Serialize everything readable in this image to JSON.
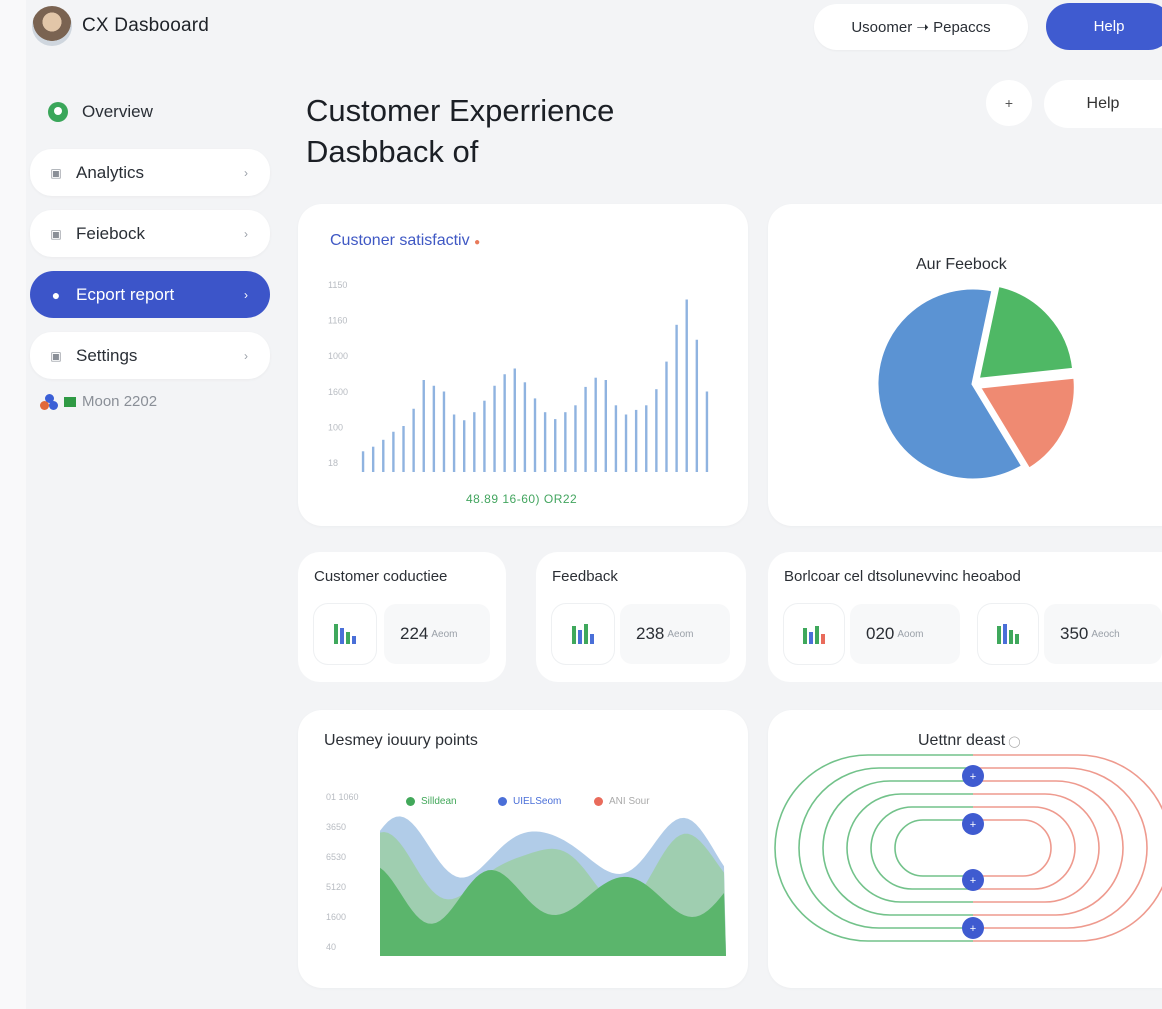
{
  "header": {
    "app_title": "CX Dasbooard",
    "breadcrumb": "Usoomer ➝ Pepaccs",
    "help_label": "Help"
  },
  "sidebar": {
    "items": [
      {
        "label": "Overview",
        "icon": "overview-icon"
      },
      {
        "label": "Analytics",
        "icon": "analytics-icon"
      },
      {
        "label": "Feiebock",
        "icon": "feedback-icon"
      },
      {
        "label": "Ecport report",
        "icon": "user-icon"
      },
      {
        "label": "Settings",
        "icon": "settings-icon"
      }
    ],
    "user_label": "Moon 2202"
  },
  "main": {
    "title": "Customer Experrience\nDasbback of",
    "plus_label": "+",
    "help_label": "Help"
  },
  "satisfaction": {
    "title": "Custoner satisfactiv",
    "footer": "48.89 16-60) OR22",
    "yticks": [
      "1150",
      "1160",
      "1000",
      "1600",
      "100",
      "18"
    ]
  },
  "pie": {
    "title": "Aur Feebock"
  },
  "metrics": [
    {
      "title": "Customer coductiee",
      "value": "224",
      "unit": "Aeom"
    },
    {
      "title": "Feedback",
      "value": "238",
      "unit": "Aeom"
    },
    {
      "title": "Borlcoar cel dtsolunevvinc heoabod",
      "value": "020",
      "unit": "Aoom",
      "value2": "350",
      "unit2": "Aeoch"
    }
  ],
  "journey": {
    "title": "Uesmey iouury points",
    "yticks": [
      "01 1060",
      "3650",
      "6530",
      "5120",
      "1600",
      "40"
    ],
    "legend": [
      {
        "label": "Silldean",
        "color": "#42a85a"
      },
      {
        "label": "UIELSeom",
        "color": "#4a6fd8"
      },
      {
        "label": "ANI Sour",
        "color": "#e96b5b"
      }
    ]
  },
  "letter": {
    "title": "Uettnr deast"
  },
  "colors": {
    "accent": "#3f5bd0",
    "green": "#3cab56",
    "blue": "#5f97d3",
    "salmon": "#ef8a72"
  },
  "chart_data": [
    {
      "type": "bar",
      "title": "Custoner satisfactiv",
      "values": [
        18,
        22,
        28,
        35,
        40,
        55,
        80,
        75,
        70,
        50,
        45,
        52,
        62,
        75,
        85,
        90,
        78,
        64,
        52,
        46,
        52,
        58,
        74,
        82,
        80,
        58,
        50,
        54,
        58,
        72,
        96,
        128,
        150,
        115,
        70
      ],
      "ylim": [
        0,
        160
      ]
    },
    {
      "type": "pie",
      "title": "Aur Feebock",
      "values": [
        62,
        18,
        20
      ],
      "colors": [
        "#5b93d3",
        "#ef8a72",
        "#4fb865"
      ]
    },
    {
      "type": "area",
      "title": "Uesmey iouury points"
    }
  ]
}
